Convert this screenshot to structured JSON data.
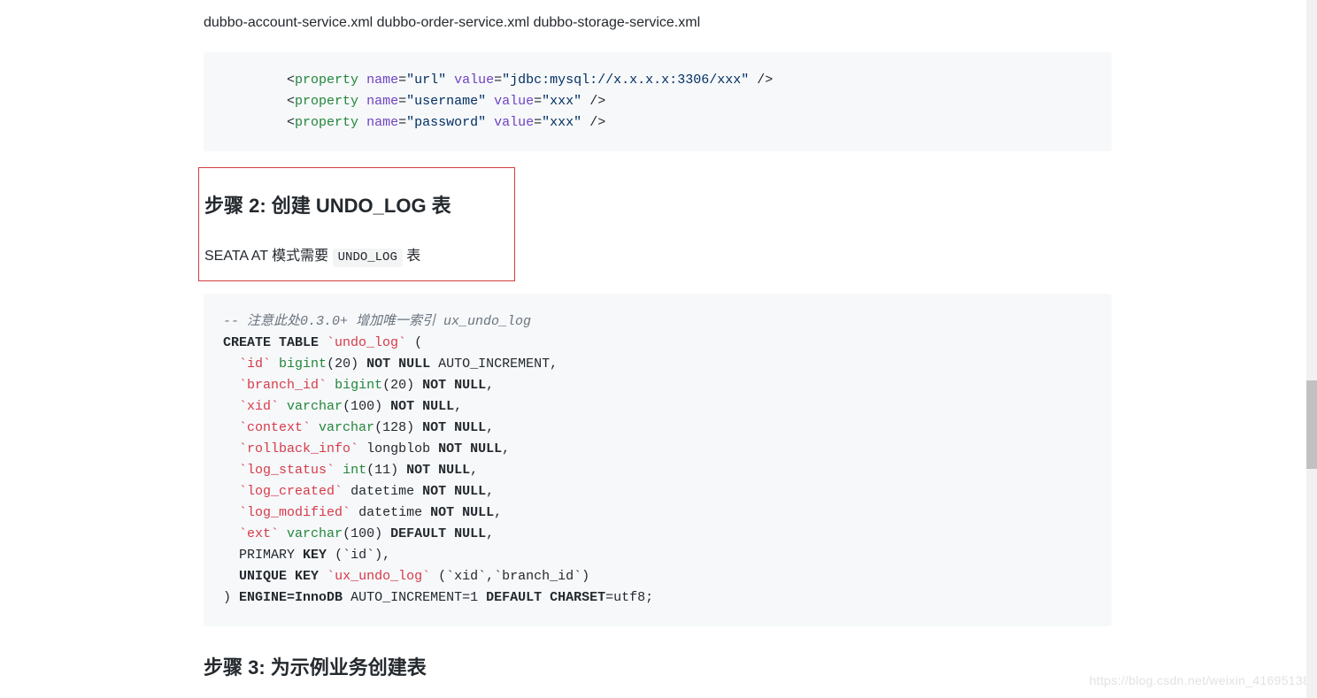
{
  "intro_files": "dubbo-account-service.xml dubbo-order-service.xml dubbo-storage-service.xml",
  "code1": {
    "indent": "        ",
    "lines": [
      {
        "attr1": "name",
        "val1": "url",
        "attr2": "value",
        "val2": "jdbc:mysql://x.x.x.x:3306/xxx"
      },
      {
        "attr1": "name",
        "val1": "username",
        "attr2": "value",
        "val2": "xxx"
      },
      {
        "attr1": "name",
        "val1": "password",
        "attr2": "value",
        "val2": "xxx"
      }
    ],
    "tag": "property"
  },
  "step2": {
    "heading": "步骤 2:  创建 UNDO_LOG 表",
    "para_before": "SEATA AT 模式需要 ",
    "code": "UNDO_LOG",
    "para_after": " 表"
  },
  "code2": {
    "comment": "-- 注意此处0.3.0+ 增加唯一索引 ux_undo_log",
    "create_kw": "CREATE TABLE",
    "table_name": "`undo_log`",
    "cols": [
      {
        "name": "`id`",
        "type_fn": "bigint",
        "type_arg": "20",
        "tail_kw": "NOT NULL",
        "tail_plain": " AUTO_INCREMENT,"
      },
      {
        "name": "`branch_id`",
        "type_fn": "bigint",
        "type_arg": "20",
        "tail_kw": "NOT NULL",
        "tail_plain": ","
      },
      {
        "name": "`xid`",
        "type_fn": "varchar",
        "type_arg": "100",
        "tail_kw": "NOT NULL",
        "tail_plain": ","
      },
      {
        "name": "`context`",
        "type_fn": "varchar",
        "type_arg": "128",
        "tail_kw": "NOT NULL",
        "tail_plain": ","
      },
      {
        "name": "`rollback_info`",
        "type_plain": "longblob",
        "tail_kw": "NOT NULL",
        "tail_plain": ","
      },
      {
        "name": "`log_status`",
        "type_fn": "int",
        "type_arg": "11",
        "tail_kw": "NOT NULL",
        "tail_plain": ","
      },
      {
        "name": "`log_created`",
        "type_plain": "datetime",
        "tail_kw": "NOT NULL",
        "tail_plain": ","
      },
      {
        "name": "`log_modified`",
        "type_plain": "datetime",
        "tail_kw": "NOT NULL",
        "tail_plain": ","
      },
      {
        "name": "`ext`",
        "type_fn": "varchar",
        "type_arg": "100",
        "tail_kw": "DEFAULT NULL",
        "tail_plain": ","
      }
    ],
    "pk_kw": "KEY",
    "pk_before": "PRIMARY ",
    "pk_args": "(`id`),",
    "uk_before": "UNIQUE",
    "uk_kw": "KEY",
    "uk_name": "`ux_undo_log`",
    "uk_args": "(`xid`,`branch_id`)",
    "closing_paren": ") ",
    "engine_kw": "ENGINE",
    "engine_eq": "=",
    "engine_val": "InnoDB",
    "ai": " AUTO_INCREMENT=1 ",
    "default_kw": "DEFAULT",
    "charset_kw": "CHARSET",
    "charset_eq": "=utf8;"
  },
  "step3": {
    "heading": "步骤 3:  为示例业务创建表"
  },
  "watermark": "https://blog.csdn.net/weixin_41695138"
}
